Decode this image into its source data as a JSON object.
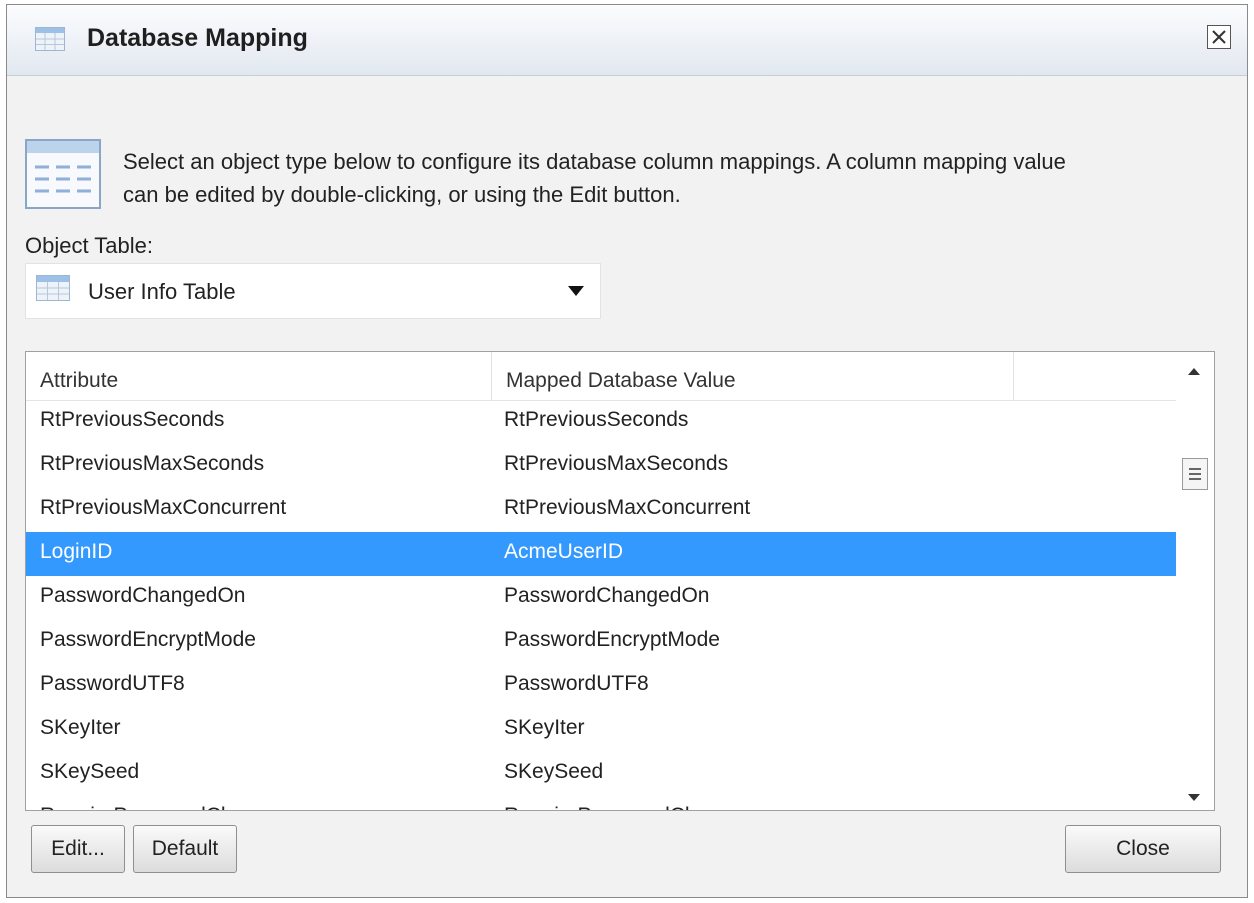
{
  "window": {
    "title": "Database Mapping",
    "title_icon": "table-icon",
    "close_icon": "close-x-icon"
  },
  "description": {
    "icon": "table-icon",
    "line1": "Select an object type below to configure its database column mappings. A column mapping value",
    "line2": "can be edited by double-clicking, or using the Edit button."
  },
  "object_table": {
    "label": "Object Table:",
    "selected": "User Info Table",
    "icon": "table-icon"
  },
  "table": {
    "columns": [
      "Attribute",
      "Mapped Database Value",
      ""
    ],
    "rows": [
      {
        "attribute": "RtPreviousSeconds",
        "value": "RtPreviousSeconds"
      },
      {
        "attribute": "RtPreviousMaxSeconds",
        "value": "RtPreviousMaxSeconds"
      },
      {
        "attribute": "RtPreviousMaxConcurrent",
        "value": "RtPreviousMaxConcurrent"
      },
      {
        "attribute": "LoginID",
        "value": "AcmeUserID"
      },
      {
        "attribute": "PasswordChangedOn",
        "value": "PasswordChangedOn"
      },
      {
        "attribute": "PasswordEncryptMode",
        "value": "PasswordEncryptMode"
      },
      {
        "attribute": "PasswordUTF8",
        "value": "PasswordUTF8"
      },
      {
        "attribute": "SKeyIter",
        "value": "SKeyIter"
      },
      {
        "attribute": "SKeySeed",
        "value": "SKeySeed"
      },
      {
        "attribute": "RequirePasswordChange",
        "value": "RequirePasswordChange"
      }
    ],
    "selected_index": 3,
    "selection_color": "#3399ff"
  },
  "buttons": {
    "edit": "Edit...",
    "default": "Default",
    "close": "Close"
  }
}
